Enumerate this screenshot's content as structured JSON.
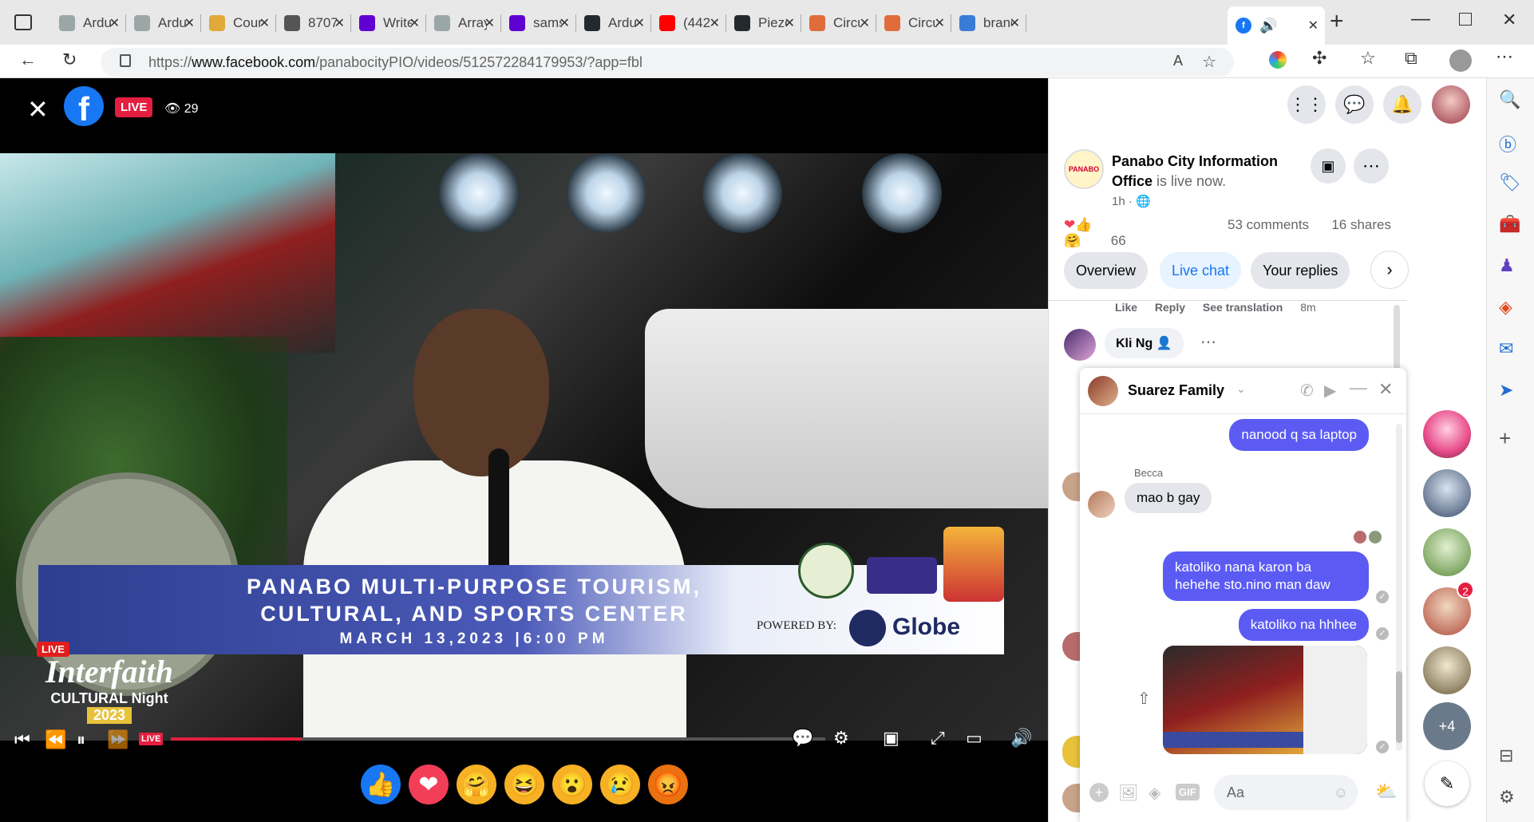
{
  "browser": {
    "tabs": [
      {
        "title": "Ardu",
        "icon": "arduino-icon",
        "color": "#9aa7a6"
      },
      {
        "title": "Ardu",
        "icon": "arduino-icon",
        "color": "#9aa7a6"
      },
      {
        "title": "Cour",
        "icon": "pencil-icon",
        "color": "#e0a93a"
      },
      {
        "title": "8707",
        "icon": "blackboard-icon",
        "color": "#555555"
      },
      {
        "title": "Write",
        "icon": "yahoo-icon",
        "color": "#6001d2"
      },
      {
        "title": "Array",
        "icon": "arduino-icon",
        "color": "#9aa7a6"
      },
      {
        "title": "sams",
        "icon": "yahoo-icon",
        "color": "#6001d2"
      },
      {
        "title": "Ardu",
        "icon": "github-icon",
        "color": "#24292e"
      },
      {
        "title": "(442",
        "icon": "youtube-icon",
        "color": "#ff0000"
      },
      {
        "title": "Piezo",
        "icon": "github-icon",
        "color": "#24292e"
      },
      {
        "title": "Circu",
        "icon": "grid-icon",
        "color": "#e06c3c"
      },
      {
        "title": "Circu",
        "icon": "grid-icon",
        "color": "#e06c3c"
      },
      {
        "title": "brand",
        "icon": "search-icon",
        "color": "#3a7bd5"
      }
    ],
    "url_prefix": "https://",
    "url_domain": "www.facebook.com",
    "url_path": "/panabocityPIO/videos/512572284179953/?app=fbl"
  },
  "video": {
    "live_label": "LIVE",
    "viewer_count": "29",
    "progress": 0.2,
    "banner_line1": "PANABO MULTI-PURPOSE TOURISM,",
    "banner_line2": "CULTURAL, AND SPORTS CENTER",
    "banner_line3": "MARCH 13,2023 |6:00 PM",
    "powered_by": "POWERED BY:",
    "sponsor": "Globe",
    "event_title": "Interfaith",
    "event_sub": "CULTURAL Night",
    "event_year": "2023",
    "live_small": "LIVE",
    "live_ctrl": "LIVE"
  },
  "post": {
    "page_name": "Panabo City Information Office",
    "status": "is live now.",
    "time": "1h ·",
    "reaction_count": "66",
    "comments": "53 comments",
    "shares": "16 shares",
    "tabs": [
      "Overview",
      "Live chat",
      "Your replies"
    ],
    "active_tab": "Live chat",
    "comment_actions": [
      "Like",
      "Reply",
      "See translation",
      "8m"
    ],
    "commenter": "Kli Ng"
  },
  "chat": {
    "title": "Suarez Family",
    "messages": [
      {
        "side": "right",
        "text": "nanood q sa laptop"
      },
      {
        "side": "left",
        "sender": "Becca",
        "text": "mao b gay"
      },
      {
        "side": "right",
        "text": "katoliko nana karon ba hehehe sto.nino man daw"
      },
      {
        "side": "right",
        "text": "katoliko na hhhee"
      }
    ],
    "input_placeholder": "Aa"
  },
  "contacts": {
    "badge_count": "2",
    "more_label": "+4"
  }
}
